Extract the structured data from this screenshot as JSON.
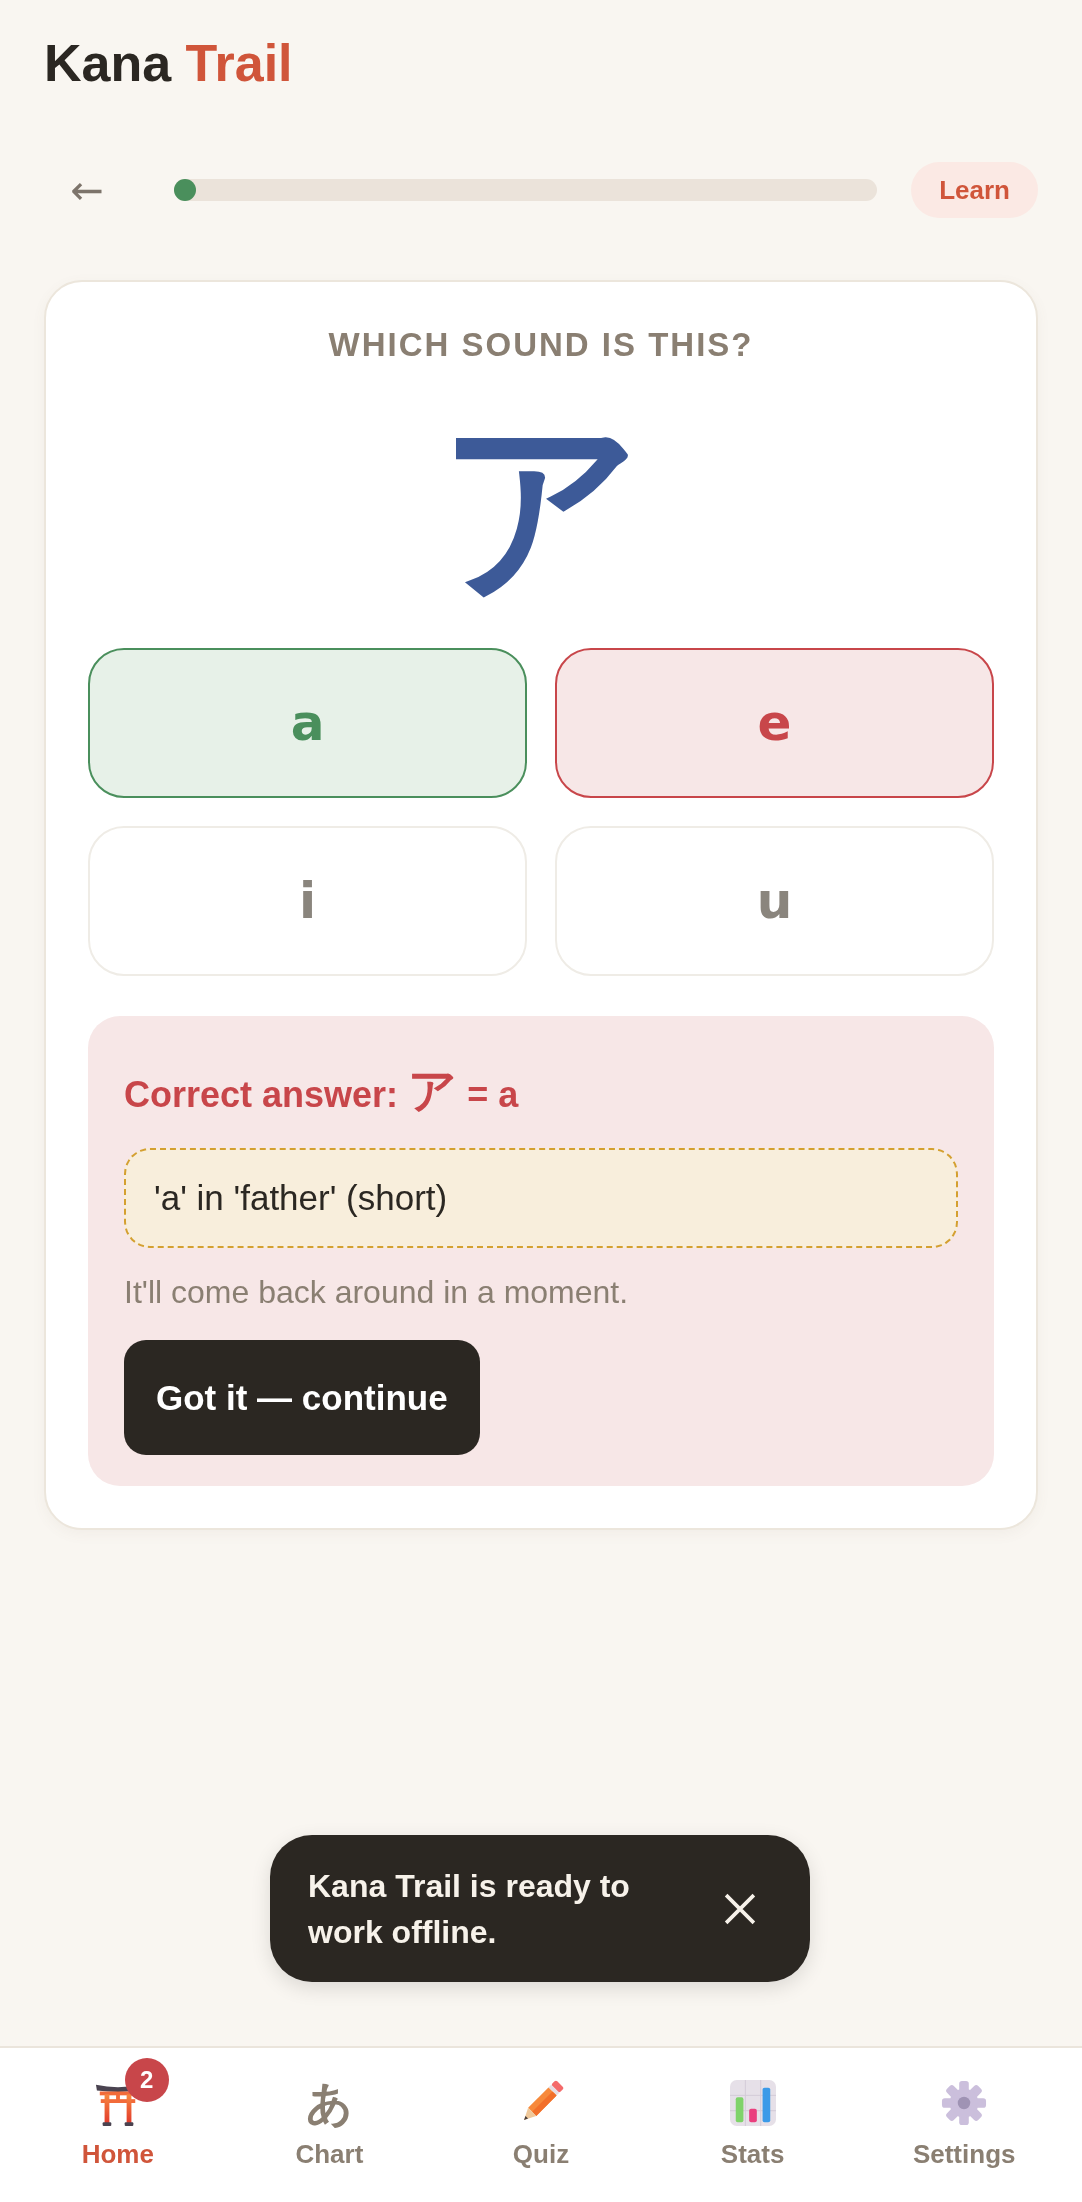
{
  "brand": {
    "name": "Kana",
    "accent": "Trail"
  },
  "progress": {
    "back": "←",
    "level": 0,
    "mode": "Learn"
  },
  "question": {
    "prompt": "WHICH SOUND IS THIS?",
    "kana": "ア",
    "options": [
      {
        "label": "a",
        "correct": true,
        "selected": false
      },
      {
        "label": "e",
        "correct": false,
        "selected": true
      },
      {
        "label": "i",
        "correct": false,
        "selected": false
      },
      {
        "label": "u",
        "correct": false,
        "selected": false
      }
    ]
  },
  "feedback": {
    "heading": "Correct answer:",
    "kana": "ア",
    "answer": "= a",
    "hint": "'a' in 'father' (short)",
    "note": "It'll come back around in a moment.",
    "button": "Got it — continue"
  },
  "toast": {
    "message": "Kana Trail is ready to work offline."
  },
  "nav": {
    "items": [
      {
        "label": "Home",
        "selected": true,
        "badge": "2"
      },
      {
        "label": "Chart",
        "glyph": "あ",
        "selected": false
      },
      {
        "label": "Quiz",
        "selected": false
      },
      {
        "label": "Stats",
        "selected": false
      },
      {
        "label": "Settings",
        "selected": false
      }
    ]
  }
}
